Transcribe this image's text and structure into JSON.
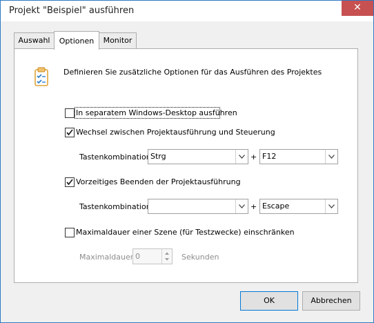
{
  "window": {
    "title": "Projekt \"Beispiel\" ausführen",
    "close_glyph": "✕"
  },
  "tabs": [
    {
      "label": "Auswahl",
      "active": false
    },
    {
      "label": "Optionen",
      "active": true
    },
    {
      "label": "Monitor",
      "active": false
    }
  ],
  "options": {
    "description": "Definieren Sie zusätzliche Optionen für das Ausführen des Projektes",
    "header_icon": "clipboard-checklist-icon",
    "separate_desktop": {
      "label": "In separatem Windows-Desktop ausführen",
      "checked": false
    },
    "switch_execution": {
      "label": "Wechsel zwischen Projektausführung und Steuerung",
      "checked": true,
      "shortcut_label": "Tastenkombination",
      "modifier": "Strg",
      "plus": "+",
      "key": "F12"
    },
    "early_abort": {
      "label": "Vorzeitiges Beenden der Projektausführung",
      "checked": true,
      "shortcut_label": "Tastenkombination",
      "modifier": "",
      "plus": "+",
      "key": "Escape"
    },
    "max_duration": {
      "label": "Maximaldauer einer Szene (für Testzwecke) einschränken",
      "checked": false,
      "field_label": "Maximaldauer",
      "value": "0",
      "unit": "Sekunden"
    }
  },
  "buttons": {
    "ok": "OK",
    "cancel": "Abbrechen"
  },
  "colors": {
    "accent": "#0078d7",
    "close_button": "#c75050",
    "icon_blue": "#2f7fd0",
    "icon_body": "#f3c26b"
  }
}
